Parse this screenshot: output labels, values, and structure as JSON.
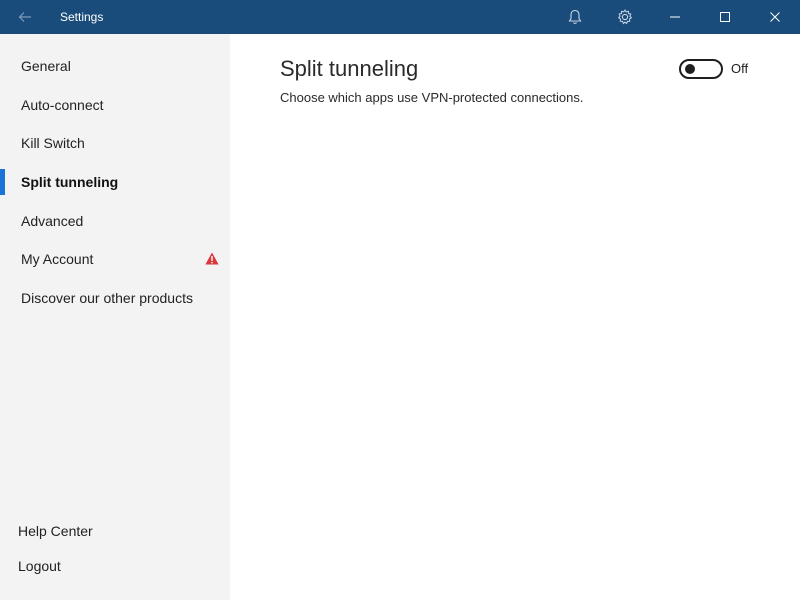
{
  "window": {
    "title": "Settings",
    "colors": {
      "titlebar": "#194c7b",
      "accent": "#1a73d6",
      "warning": "#d9363e"
    },
    "icons": [
      "back-arrow-icon",
      "bell-icon",
      "gear-icon",
      "minimize-icon",
      "maximize-icon",
      "close-icon"
    ]
  },
  "sidebar": {
    "items": [
      {
        "label": "General"
      },
      {
        "label": "Auto-connect"
      },
      {
        "label": "Kill Switch"
      },
      {
        "label": "Split tunneling",
        "active": true
      },
      {
        "label": "Advanced"
      },
      {
        "label": "My Account",
        "warning": true
      },
      {
        "label": "Discover our other products"
      }
    ],
    "bottom": [
      {
        "label": "Help Center"
      },
      {
        "label": "Logout"
      }
    ]
  },
  "main": {
    "title": "Split tunneling",
    "description": "Choose which apps use VPN-protected connections.",
    "toggle": {
      "state_label": "Off",
      "on": false
    }
  }
}
